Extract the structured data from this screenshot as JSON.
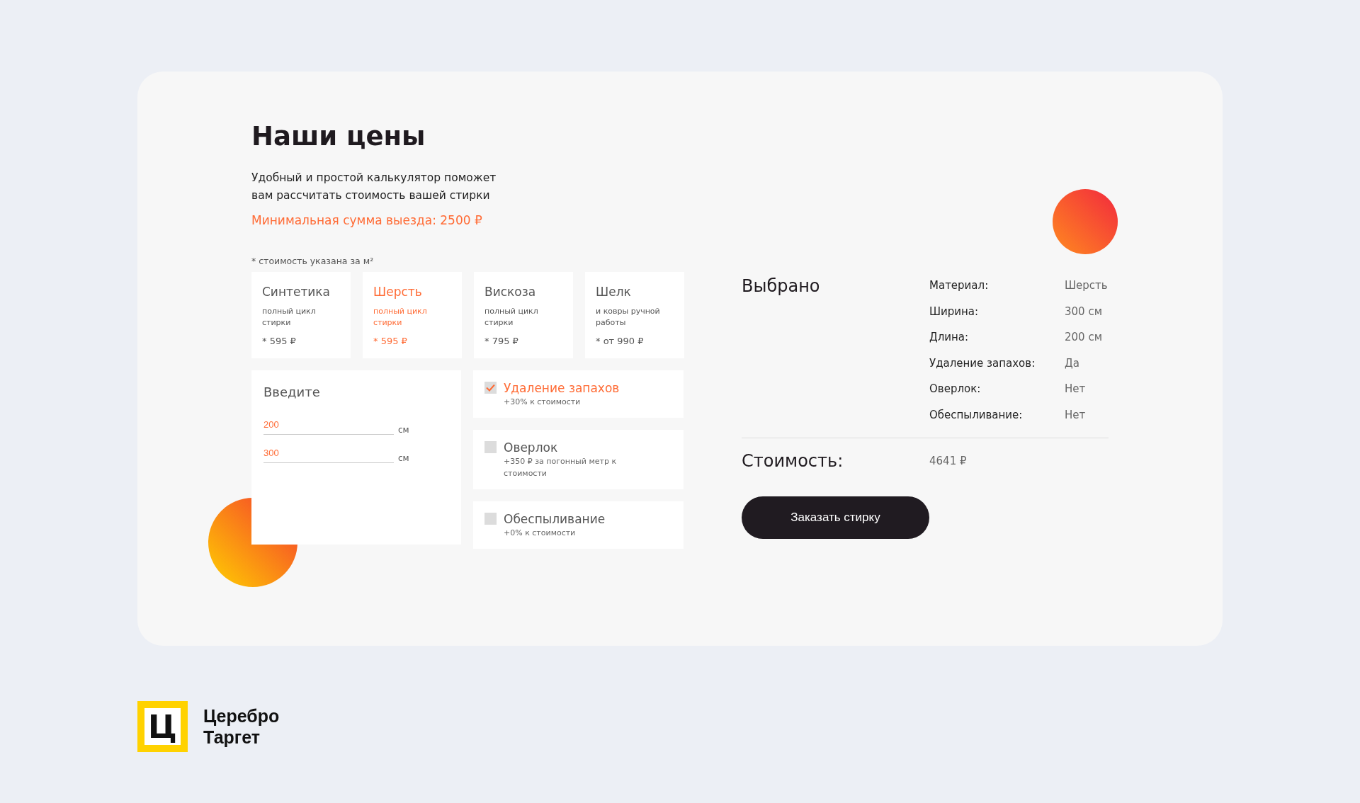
{
  "heading": "Наши цены",
  "description": "Удобный и простой калькулятор поможет вам рассчитать стоимость вашей стирки",
  "minimum_order": "Минимальная сумма выезда: 2500 ₽",
  "price_note": "* стоимость указана за м²",
  "materials": [
    {
      "name": "Синтетика",
      "subtitle": "полный цикл стирки",
      "price": "* 595 ₽",
      "selected": false
    },
    {
      "name": "Шерсть",
      "subtitle": "полный цикл стирки",
      "price": "* 595 ₽",
      "selected": true
    },
    {
      "name": "Вискоза",
      "subtitle": "полный цикл стирки",
      "price": "* 795 ₽",
      "selected": false
    },
    {
      "name": "Шелк",
      "subtitle": "и ковры ручной работы",
      "price": "* от 990 ₽",
      "selected": false
    }
  ],
  "dimensions": {
    "title": "Введите",
    "fields": [
      {
        "value": "200",
        "unit": "см"
      },
      {
        "value": "300",
        "unit": "см"
      }
    ]
  },
  "options": [
    {
      "name": "Удаление запахов",
      "note": "+30% к стоимости",
      "checked": true
    },
    {
      "name": "Оверлок",
      "note": "+350 ₽ за погонный метр к стоимости",
      "checked": false
    },
    {
      "name": "Обеспыливание",
      "note": "+0% к стоимости",
      "checked": false
    }
  ],
  "summary": {
    "title": "Выбрано",
    "rows": [
      {
        "label": "Материал:",
        "value": "Шерсть"
      },
      {
        "label": "Ширина:",
        "value": "300 см"
      },
      {
        "label": "Длина:",
        "value": "200 см"
      },
      {
        "label": "Удаление запахов:",
        "value": "Да"
      },
      {
        "label": "Оверлок:",
        "value": "Нет"
      },
      {
        "label": "Обеспыливание:",
        "value": "Нет"
      }
    ],
    "total_label": "Стоимость:",
    "total_value": "4641 ₽"
  },
  "order_button": "Заказать стирку",
  "logo": {
    "mark": "Ц",
    "lines": [
      "Церебро",
      "Таргет"
    ]
  }
}
